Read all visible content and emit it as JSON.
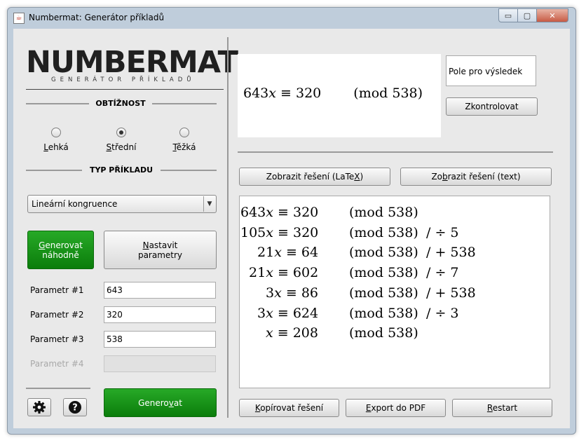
{
  "window": {
    "title": "Numbermat: Generátor příkladů",
    "controls": [
      "minimize",
      "maximize",
      "close"
    ]
  },
  "logo": {
    "main": "NUMBERMAT",
    "sub": "GENERÁTOR PŘÍKLADŮ"
  },
  "difficulty": {
    "title": "OBTÍŽNOST",
    "options": [
      {
        "label": "Lehká",
        "mnemonic": "L",
        "rest": "ehká",
        "selected": false
      },
      {
        "label": "Střední",
        "mnemonic": "S",
        "rest": "třední",
        "selected": true
      },
      {
        "label": "Těžká",
        "mnemonic": "T",
        "rest": "ěžká",
        "selected": false
      }
    ]
  },
  "example_type": {
    "title": "TYP PŘÍKLADU",
    "selected": "Lineární kongruence"
  },
  "buttons": {
    "generate_random": {
      "line1_mn": "G",
      "line1_rest": "enerovat",
      "line2": "náhodně"
    },
    "set_params": {
      "line1_mn": "N",
      "line1_rest": "astavit",
      "line2": "parametry"
    },
    "generate": {
      "pre": "Genero",
      "mn": "v",
      "post": "at"
    },
    "check": "Zkontrolovat",
    "show_latex": {
      "pre": "Zobrazit řešení (LaTe",
      "mn": "X",
      "post": ")"
    },
    "show_text": {
      "pre": "Zo",
      "mn": "b",
      "post": "razit řešení (text)"
    },
    "copy": {
      "mn": "K",
      "rest": "opírovat řešení"
    },
    "export": {
      "mn": "E",
      "rest": "xport do PDF"
    },
    "restart": {
      "mn": "R",
      "rest": "estart"
    }
  },
  "parameters": [
    {
      "label": "Parametr #1",
      "value": "643",
      "enabled": true
    },
    {
      "label": "Parametr #2",
      "value": "320",
      "enabled": true
    },
    {
      "label": "Parametr #3",
      "value": "538",
      "enabled": true
    },
    {
      "label": "Parametr #4",
      "value": "",
      "enabled": false
    }
  ],
  "icons": {
    "settings": "gear-icon",
    "help": "question-icon"
  },
  "problem": {
    "a": "643",
    "b": "320",
    "m": "538"
  },
  "result_field": {
    "value": "Pole pro výsledek"
  },
  "solution": [
    {
      "coef": "643",
      "rhs": "320",
      "mod": "538",
      "op": ""
    },
    {
      "coef": "105",
      "rhs": "320",
      "mod": "538",
      "op": "/ ÷ 5"
    },
    {
      "coef": "21",
      "rhs": "64",
      "mod": "538",
      "op": "/ + 538"
    },
    {
      "coef": "21",
      "rhs": "602",
      "mod": "538",
      "op": "/ ÷ 7"
    },
    {
      "coef": "3",
      "rhs": "86",
      "mod": "538",
      "op": "/ + 538"
    },
    {
      "coef": "3",
      "rhs": "624",
      "mod": "538",
      "op": "/ ÷ 3"
    },
    {
      "coef": "",
      "rhs": "208",
      "mod": "538",
      "op": ""
    }
  ]
}
